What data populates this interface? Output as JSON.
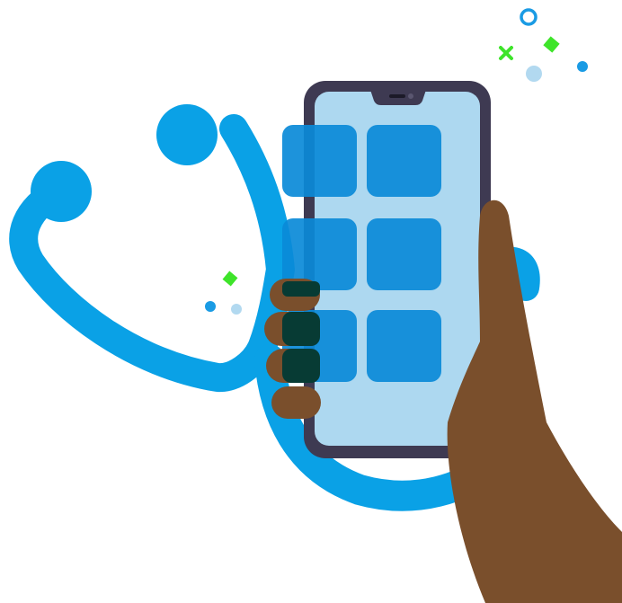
{
  "illustration": {
    "subject": "hand-holding-smartphone-with-stethoscope",
    "app_tile_count": 6,
    "icons": [
      "stethoscope-icon",
      "smartphone-icon",
      "hand-icon",
      "app-tile-icon",
      "confetti-icon"
    ]
  },
  "colors": {
    "background": "#ffffff",
    "stethoscope": "#0aa1e6",
    "phone_frame": "#3e3a52",
    "phone_screen": "#add8f0",
    "app_tile": "#0a8ad8",
    "skin": "#7a4f2c",
    "finger_overlap": "#073b34",
    "confetti_green": "#3ee42a",
    "confetti_blue": "#1a9be4",
    "confetti_light_blue": "#b2d9f0"
  }
}
